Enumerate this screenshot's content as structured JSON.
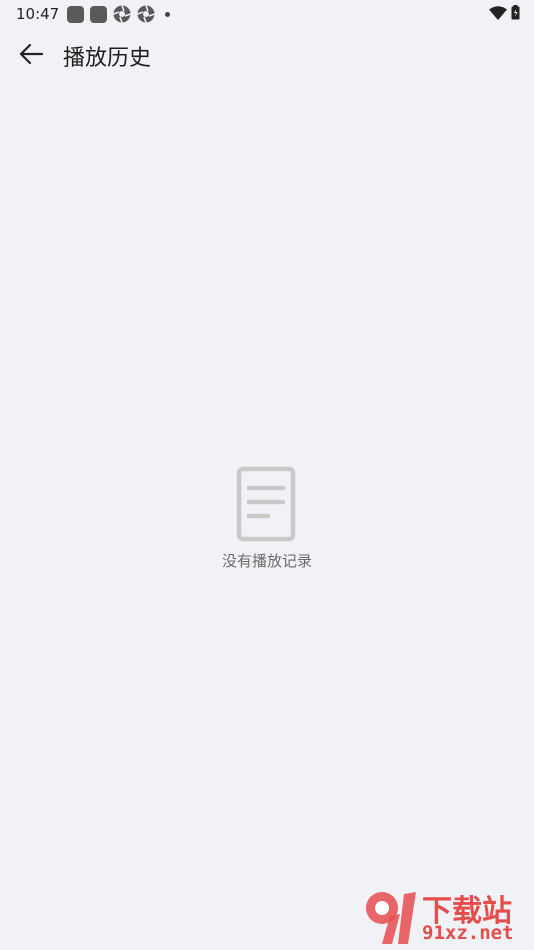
{
  "status_bar": {
    "time": "10:47",
    "icons": [
      "app-square-icon",
      "app-square-icon",
      "aperture-icon",
      "aperture-icon",
      "notification-dot-icon",
      "wifi-icon",
      "battery-icon"
    ]
  },
  "app_bar": {
    "back_icon": "arrow-left-icon",
    "title": "播放历史"
  },
  "empty_state": {
    "icon": "document-icon",
    "message": "没有播放记录"
  },
  "watermark": {
    "badge": "91",
    "site_name": "下载站",
    "url": "91xz.net",
    "color": "#e64d4d"
  }
}
